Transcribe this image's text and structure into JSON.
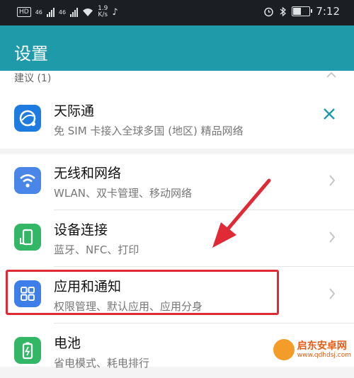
{
  "status_bar": {
    "hd_badge": "HD",
    "signal1_label": "46",
    "signal2_label": "46",
    "net_speed_value": "1.9",
    "net_speed_unit": "K/s",
    "time": "7:12",
    "battery_level": 0.45
  },
  "app_bar": {
    "title": "设置"
  },
  "suggestions": {
    "header": "建议 (1)",
    "item": {
      "title": "天际通",
      "subtitle": "免 SIM 卡接入全球多国 (地区) 精品网络"
    }
  },
  "items": [
    {
      "title": "无线和网络",
      "subtitle": "WLAN、双卡管理、移动网络",
      "icon": "wifi-icon",
      "color": "#4a86e8"
    },
    {
      "title": "设备连接",
      "subtitle": "蓝牙、NFC、打印",
      "icon": "device-connection-icon",
      "color": "#33b766"
    },
    {
      "title": "应用和通知",
      "subtitle": "权限管理、默认应用、应用分身",
      "icon": "apps-grid-icon",
      "color": "#3d7ee8"
    },
    {
      "title": "电池",
      "subtitle": "省电模式、耗电排行",
      "icon": "battery-icon",
      "color": "#33b766"
    }
  ],
  "watermark": {
    "name": "启东安卓网",
    "url": "www.qdhdsj.com"
  },
  "colors": {
    "accent": "#1e9aa8",
    "highlight": "#e02a36",
    "status_bar": "#1b1f24"
  }
}
